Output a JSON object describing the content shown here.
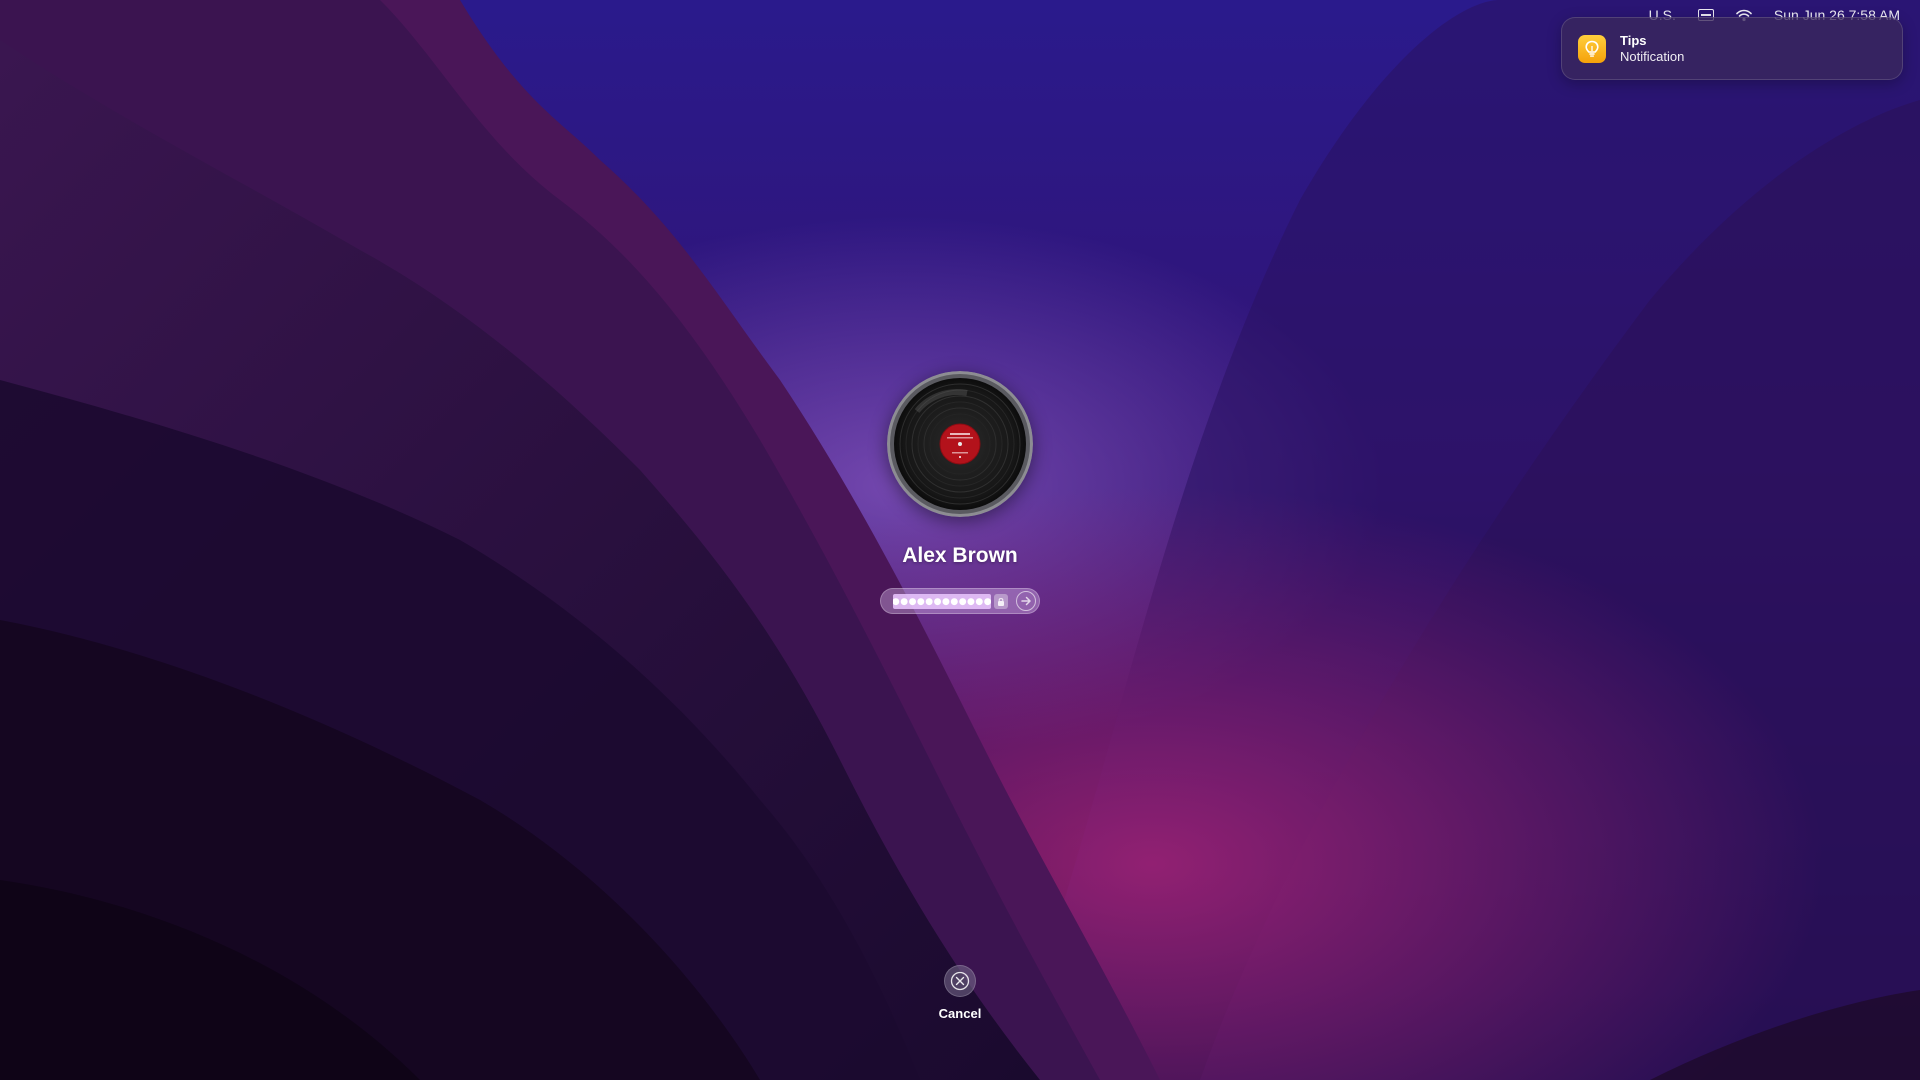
{
  "menubar": {
    "input_source": "U.S.",
    "datetime": "Sun Jun 26  7:58 AM"
  },
  "notification": {
    "app_icon": "lightbulb-icon",
    "title": "Tips",
    "body": "Notification"
  },
  "login": {
    "user_name": "Alex Brown",
    "password_masked": "●●●●●●●●●●●●",
    "avatar": "vinyl-record-icon"
  },
  "cancel": {
    "label": "Cancel",
    "icon": "close-icon"
  },
  "colors": {
    "wallpaper_base": "#1c0a3a",
    "wallpaper_accent": "#7a1f7a",
    "notif_icon": "#f5b321"
  }
}
